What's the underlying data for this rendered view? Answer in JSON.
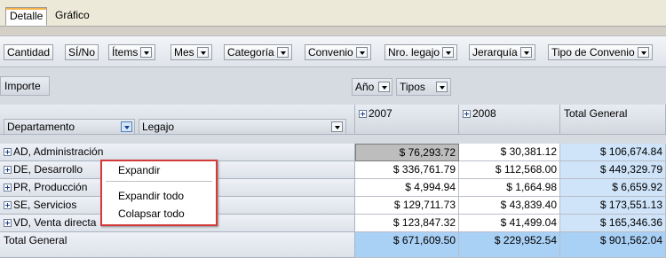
{
  "tabs": {
    "detail": "Detalle",
    "chart": "Gráfico"
  },
  "field_chips": [
    {
      "label": "Cantidad",
      "has_dropdown": false
    },
    {
      "label": "SÍ/No",
      "has_dropdown": false
    },
    {
      "label": "Ítems",
      "has_dropdown": true
    },
    {
      "label": "Mes",
      "has_dropdown": true
    },
    {
      "label": "Categoría",
      "has_dropdown": true
    },
    {
      "label": "Convenio",
      "has_dropdown": true
    },
    {
      "label": "Nro. legajo",
      "has_dropdown": true
    },
    {
      "label": "Jerarquía",
      "has_dropdown": true
    },
    {
      "label": "Tipo de Convenio",
      "has_dropdown": true
    }
  ],
  "pivot": {
    "data_field": "Importe",
    "column_fields": [
      "Año",
      "Tipos"
    ],
    "row_fields": [
      "Departamento",
      "Legajo"
    ],
    "columns": [
      "2007",
      "2008",
      "Total General"
    ],
    "rows": [
      {
        "label": "AD, Administración",
        "v2007": "$ 76,293.72",
        "v2008": "$ 30,381.12",
        "total": "$ 106,674.84"
      },
      {
        "label": "DE, Desarrollo",
        "v2007": "$ 336,761.79",
        "v2008": "$ 112,568.00",
        "total": "$ 449,329.79"
      },
      {
        "label": "PR, Producción",
        "v2007": "$ 4,994.94",
        "v2008": "$ 1,664.98",
        "total": "$ 6,659.92"
      },
      {
        "label": "SE, Servicios",
        "v2007": "$ 129,711.73",
        "v2008": "$ 43,839.40",
        "total": "$ 173,551.13"
      },
      {
        "label": "VD, Venta directa",
        "v2007": "$ 123,847.32",
        "v2008": "$ 41,499.04",
        "total": "$ 165,346.36"
      }
    ],
    "grand_total": {
      "label": "Total General",
      "v2007": "$ 671,609.50",
      "v2008": "$ 229,952.54",
      "total": "$ 901,562.04"
    }
  },
  "context_menu": {
    "expand": "Expandir",
    "expand_all": "Expandir todo",
    "collapse_all": "Colapsar todo"
  },
  "colors": {
    "accent_border": "#d43a3a",
    "total_col": "#cfe4f9",
    "grand_total": "#a9d0f5"
  }
}
